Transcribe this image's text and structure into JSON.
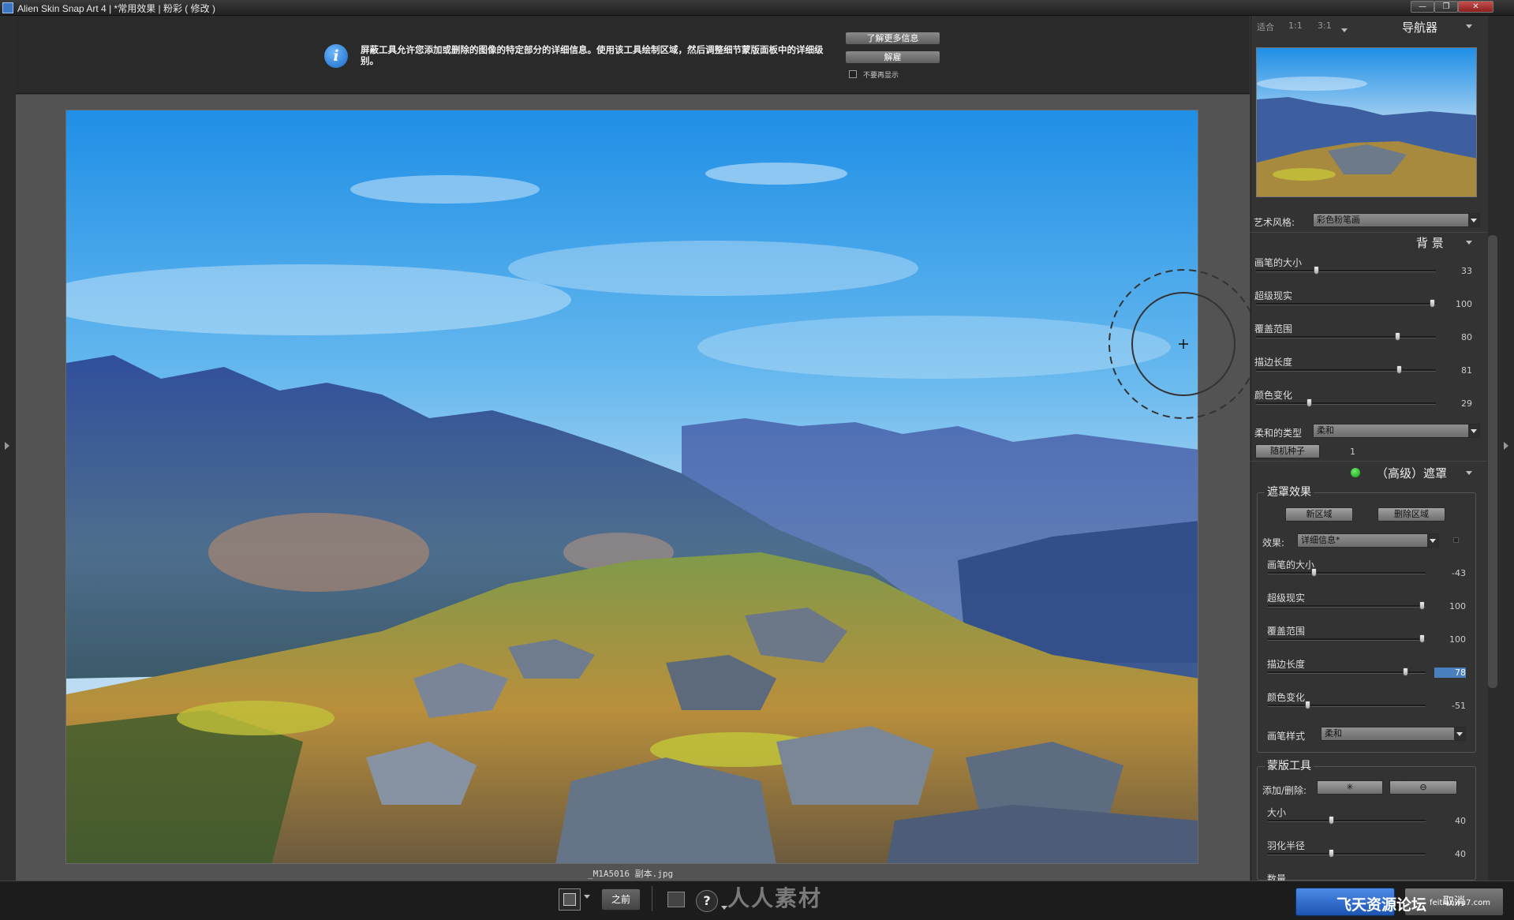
{
  "window": {
    "title": "Alien Skin Snap Art 4 | *常用效果 | 粉彩 ( 修改 )",
    "min": "—",
    "max": "❐",
    "close": "✕"
  },
  "banner": {
    "text": "屏蔽工具允许您添加或删除的图像的特定部分的详细信息。使用该工具绘制区域，然后调整细节蒙版面板中的详细级别。",
    "learn_more": "了解更多信息",
    "dismiss": "解雇",
    "no_show_again": "不要再显示",
    "icon": "i"
  },
  "canvas": {
    "file_name": "_M1A5016 副本.jpg"
  },
  "navigator": {
    "zoom_fit": "适合",
    "zoom_1": "1:1",
    "zoom_3": "3:1",
    "title": "导航器"
  },
  "art_style": {
    "label": "艺术风格:",
    "value": "彩色粉笔画"
  },
  "background": {
    "title": "背 景",
    "sliders": [
      {
        "label": "画笔的大小",
        "value": "33",
        "pos": 0.33
      },
      {
        "label": "超级现实",
        "value": "100",
        "pos": 1.0
      },
      {
        "label": "覆盖范围",
        "value": "80",
        "pos": 0.8
      },
      {
        "label": "描边长度",
        "value": "81",
        "pos": 0.81
      },
      {
        "label": "颜色变化",
        "value": "29",
        "pos": 0.29
      }
    ],
    "soft_type_label": "柔和的类型",
    "soft_type_value": "柔和",
    "seed_button": "随机种子",
    "seed_value": "1"
  },
  "mask": {
    "title": "（高级）遮罩",
    "effects_title": "遮罩效果",
    "new_region": "新区域",
    "delete_region": "删除区域",
    "effect_label": "效果:",
    "effect_value": "详细信息*",
    "sliders": [
      {
        "label": "画笔的大小",
        "value": "-43",
        "pos": 0.285
      },
      {
        "label": "超级现实",
        "value": "100",
        "pos": 1.0
      },
      {
        "label": "覆盖范围",
        "value": "100",
        "pos": 1.0
      },
      {
        "label": "描边长度",
        "value": "78",
        "pos": 0.89
      },
      {
        "label": "颜色变化",
        "value": "-51",
        "pos": 0.245
      }
    ],
    "brush_style_label": "画笔样式",
    "brush_style_value": "柔和"
  },
  "mask_tools": {
    "title": "蒙版工具",
    "add_remove_label": "添加/删除:",
    "add_icon": "✳",
    "remove_icon": "⊖",
    "sliders": [
      {
        "label": "大小",
        "value": "40",
        "pos": 0.4
      },
      {
        "label": "羽化半径",
        "value": "40",
        "pos": 0.4
      },
      {
        "label": "数量",
        "value": "",
        "pos": 0.4
      }
    ]
  },
  "bottom": {
    "before": "之前",
    "help": "?",
    "watermark": "人人素材",
    "ok": "飞天资源论坛",
    "cancel": "取消",
    "corner_watermark": "feitianwu7.com"
  }
}
